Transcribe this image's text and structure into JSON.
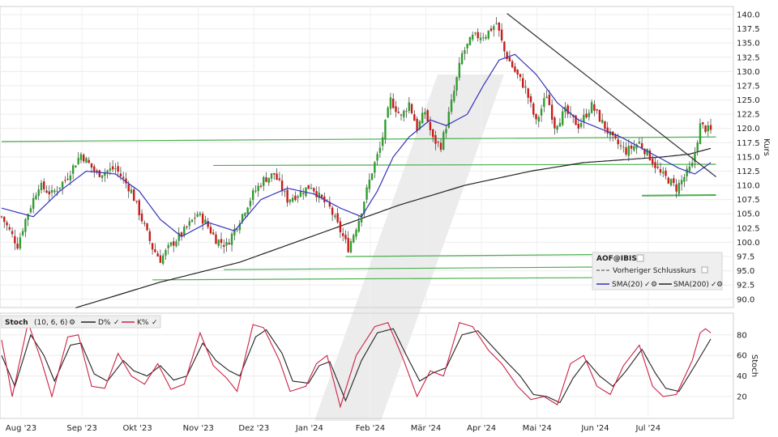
{
  "chart_data": [
    {
      "type": "candlestick",
      "title": "",
      "symbol_label": "AOF@IBIS",
      "ylabel": "Kurs",
      "ylim": [
        88,
        141
      ],
      "y_ticks": [
        90.0,
        92.5,
        95.0,
        97.5,
        100.0,
        102.5,
        105.0,
        107.5,
        110.0,
        112.5,
        115.0,
        117.5,
        120.0,
        122.5,
        125.0,
        127.5,
        130.0,
        132.5,
        135.0,
        137.5,
        140.0
      ],
      "x_ticks": [
        "Aug '23",
        "Sep '23",
        "Okt '23",
        "Nov '23",
        "Dez '23",
        "Jan '24",
        "Feb '24",
        "Mär '24",
        "Apr '24",
        "Mai '24",
        "Jun '24",
        "Jul '24"
      ],
      "x_range": [
        0,
        255
      ],
      "month_start_index": [
        20,
        43,
        64,
        87,
        108,
        129,
        152,
        173,
        194,
        215,
        237,
        257
      ],
      "legend": {
        "symbol": "AOF@IBIS",
        "items": [
          "Vorheriger Schlusskurs",
          "SMA(20)",
          "SMA(200)"
        ]
      },
      "colors": {
        "up": "#2e9e2e",
        "down": "#cc1a1a",
        "sma20": "#3333bb",
        "sma200": "#222222",
        "support": "#4caf50",
        "trend": "#333333"
      },
      "close_anchors": [
        [
          0,
          104.5
        ],
        [
          6,
          99.5
        ],
        [
          9,
          104
        ],
        [
          14,
          110
        ],
        [
          19,
          108.5
        ],
        [
          24,
          111
        ],
        [
          30,
          115.5
        ],
        [
          36,
          112
        ],
        [
          43,
          113
        ],
        [
          49,
          109
        ],
        [
          53,
          104
        ],
        [
          57,
          99
        ],
        [
          60,
          97
        ],
        [
          64,
          99.5
        ],
        [
          69,
          102
        ],
        [
          74,
          105
        ],
        [
          77,
          103.5
        ],
        [
          81,
          100.5
        ],
        [
          85,
          99.5
        ],
        [
          90,
          104
        ],
        [
          95,
          108.5
        ],
        [
          99,
          111
        ],
        [
          103,
          112
        ],
        [
          108,
          107.5
        ],
        [
          112,
          108.5
        ],
        [
          117,
          110
        ],
        [
          120,
          108
        ],
        [
          124,
          106
        ],
        [
          128,
          102
        ],
        [
          131,
          99
        ],
        [
          135,
          104
        ],
        [
          140,
          112.5
        ],
        [
          143,
          116.5
        ],
        [
          147,
          125
        ],
        [
          151,
          122
        ],
        [
          154,
          124.5
        ],
        [
          157,
          120
        ],
        [
          160,
          123
        ],
        [
          163,
          118
        ],
        [
          166,
          117
        ],
        [
          168,
          120.5
        ],
        [
          171,
          126.5
        ],
        [
          174,
          133
        ],
        [
          178,
          136
        ],
        [
          183,
          136.5
        ],
        [
          187,
          138.5
        ],
        [
          190,
          133.5
        ],
        [
          194,
          130
        ],
        [
          198,
          127
        ],
        [
          202,
          121
        ],
        [
          206,
          126
        ],
        [
          209,
          120.5
        ],
        [
          213,
          123
        ],
        [
          218,
          120.5
        ],
        [
          223,
          124
        ],
        [
          227,
          121
        ],
        [
          231,
          118
        ],
        [
          236,
          116
        ],
        [
          241,
          117.5
        ],
        [
          245,
          115
        ],
        [
          249,
          112
        ],
        [
          252,
          111
        ],
        [
          255,
          109.5
        ],
        [
          258,
          111.5
        ],
        [
          261,
          113.5
        ],
        [
          264,
          120.5
        ],
        [
          268,
          119.5
        ]
      ],
      "sma20_anchors": [
        [
          0,
          106
        ],
        [
          12,
          104.5
        ],
        [
          22,
          109
        ],
        [
          32,
          112.5
        ],
        [
          43,
          112
        ],
        [
          52,
          109
        ],
        [
          60,
          104
        ],
        [
          68,
          101
        ],
        [
          78,
          103.5
        ],
        [
          88,
          102
        ],
        [
          98,
          107.5
        ],
        [
          108,
          109.5
        ],
        [
          118,
          108.5
        ],
        [
          128,
          106
        ],
        [
          136,
          104.5
        ],
        [
          142,
          109
        ],
        [
          148,
          115
        ],
        [
          154,
          118.5
        ],
        [
          162,
          121.5
        ],
        [
          168,
          120.5
        ],
        [
          176,
          122.5
        ],
        [
          182,
          127.5
        ],
        [
          188,
          132
        ],
        [
          194,
          133
        ],
        [
          202,
          129.5
        ],
        [
          210,
          124.5
        ],
        [
          218,
          121.5
        ],
        [
          226,
          120
        ],
        [
          234,
          118.5
        ],
        [
          242,
          116.5
        ],
        [
          250,
          114.5
        ],
        [
          256,
          113
        ],
        [
          262,
          112
        ],
        [
          268,
          114
        ]
      ],
      "sma200_anchors": [
        [
          28,
          88.5
        ],
        [
          60,
          93
        ],
        [
          90,
          96.5
        ],
        [
          120,
          101.5
        ],
        [
          150,
          106.5
        ],
        [
          175,
          110
        ],
        [
          200,
          112.5
        ],
        [
          220,
          114
        ],
        [
          235,
          114.5
        ],
        [
          250,
          115
        ],
        [
          260,
          115.5
        ],
        [
          268,
          116.5
        ]
      ],
      "support_lines": [
        {
          "from": [
            0,
            117.7
          ],
          "to": [
            270,
            118.5
          ]
        },
        {
          "from": [
            80,
            113.5
          ],
          "to": [
            270,
            113.7
          ]
        },
        {
          "from": [
            130,
            97.5
          ],
          "to": [
            270,
            98.0
          ]
        },
        {
          "from": [
            84,
            95.2
          ],
          "to": [
            270,
            95.8
          ]
        },
        {
          "from": [
            57,
            93.4
          ],
          "to": [
            270,
            93.9
          ]
        },
        {
          "from": [
            242,
            108.2
          ],
          "to": [
            270,
            108.3
          ]
        }
      ],
      "trend_lines": [
        {
          "from": [
            191,
            140.2
          ],
          "to": [
            270,
            111.5
          ]
        },
        {
          "from": [
            28,
            88.5
          ],
          "to": [
            137,
            101.2
          ]
        }
      ]
    },
    {
      "type": "line",
      "title": "Stoch",
      "params": "(10, 6, 6)",
      "ylabel": "Stoch",
      "ylim": [
        7,
        93
      ],
      "y_ticks": [
        20,
        40,
        60,
        80
      ],
      "series": [
        {
          "name": "D%",
          "color": "#222222",
          "anchors": [
            [
              0,
              60
            ],
            [
              5,
              30
            ],
            [
              11,
              80
            ],
            [
              16,
              60
            ],
            [
              20,
              35
            ],
            [
              26,
              70
            ],
            [
              30,
              72
            ],
            [
              35,
              42
            ],
            [
              40,
              35
            ],
            [
              46,
              55
            ],
            [
              50,
              45
            ],
            [
              55,
              40
            ],
            [
              60,
              50
            ],
            [
              65,
              36
            ],
            [
              70,
              40
            ],
            [
              76,
              72
            ],
            [
              81,
              55
            ],
            [
              86,
              45
            ],
            [
              90,
              40
            ],
            [
              96,
              78
            ],
            [
              100,
              85
            ],
            [
              106,
              62
            ],
            [
              110,
              35
            ],
            [
              116,
              33
            ],
            [
              120,
              50
            ],
            [
              124,
              54
            ],
            [
              130,
              16
            ],
            [
              136,
              55
            ],
            [
              142,
              82
            ],
            [
              148,
              86
            ],
            [
              153,
              60
            ],
            [
              158,
              35
            ],
            [
              163,
              43
            ],
            [
              168,
              48
            ],
            [
              174,
              80
            ],
            [
              180,
              84
            ],
            [
              185,
              70
            ],
            [
              190,
              56
            ],
            [
              196,
              40
            ],
            [
              201,
              22
            ],
            [
              206,
              20
            ],
            [
              211,
              14
            ],
            [
              216,
              38
            ],
            [
              221,
              55
            ],
            [
              226,
              40
            ],
            [
              231,
              30
            ],
            [
              236,
              45
            ],
            [
              242,
              66
            ],
            [
              247,
              43
            ],
            [
              251,
              28
            ],
            [
              256,
              25
            ],
            [
              262,
              50
            ],
            [
              268,
              76
            ]
          ]
        },
        {
          "name": "K%",
          "color": "#cc2244",
          "anchors": [
            [
              0,
              75
            ],
            [
              4,
              20
            ],
            [
              10,
              92
            ],
            [
              15,
              55
            ],
            [
              19,
              20
            ],
            [
              25,
              78
            ],
            [
              29,
              80
            ],
            [
              34,
              30
            ],
            [
              39,
              28
            ],
            [
              44,
              62
            ],
            [
              49,
              40
            ],
            [
              54,
              32
            ],
            [
              59,
              52
            ],
            [
              64,
              27
            ],
            [
              69,
              32
            ],
            [
              75,
              82
            ],
            [
              80,
              50
            ],
            [
              85,
              38
            ],
            [
              89,
              25
            ],
            [
              95,
              90
            ],
            [
              99,
              87
            ],
            [
              105,
              55
            ],
            [
              109,
              25
            ],
            [
              115,
              30
            ],
            [
              119,
              52
            ],
            [
              123,
              60
            ],
            [
              128,
              10
            ],
            [
              134,
              60
            ],
            [
              141,
              88
            ],
            [
              146,
              92
            ],
            [
              152,
              55
            ],
            [
              157,
              20
            ],
            [
              162,
              45
            ],
            [
              167,
              40
            ],
            [
              173,
              92
            ],
            [
              178,
              88
            ],
            [
              184,
              65
            ],
            [
              189,
              52
            ],
            [
              195,
              30
            ],
            [
              200,
              17
            ],
            [
              205,
              20
            ],
            [
              210,
              12
            ],
            [
              215,
              52
            ],
            [
              220,
              60
            ],
            [
              225,
              30
            ],
            [
              230,
              22
            ],
            [
              235,
              50
            ],
            [
              241,
              70
            ],
            [
              246,
              30
            ],
            [
              250,
              20
            ],
            [
              255,
              22
            ],
            [
              261,
              55
            ],
            [
              264,
              82
            ],
            [
              266,
              86
            ],
            [
              268,
              82
            ]
          ]
        }
      ]
    }
  ]
}
